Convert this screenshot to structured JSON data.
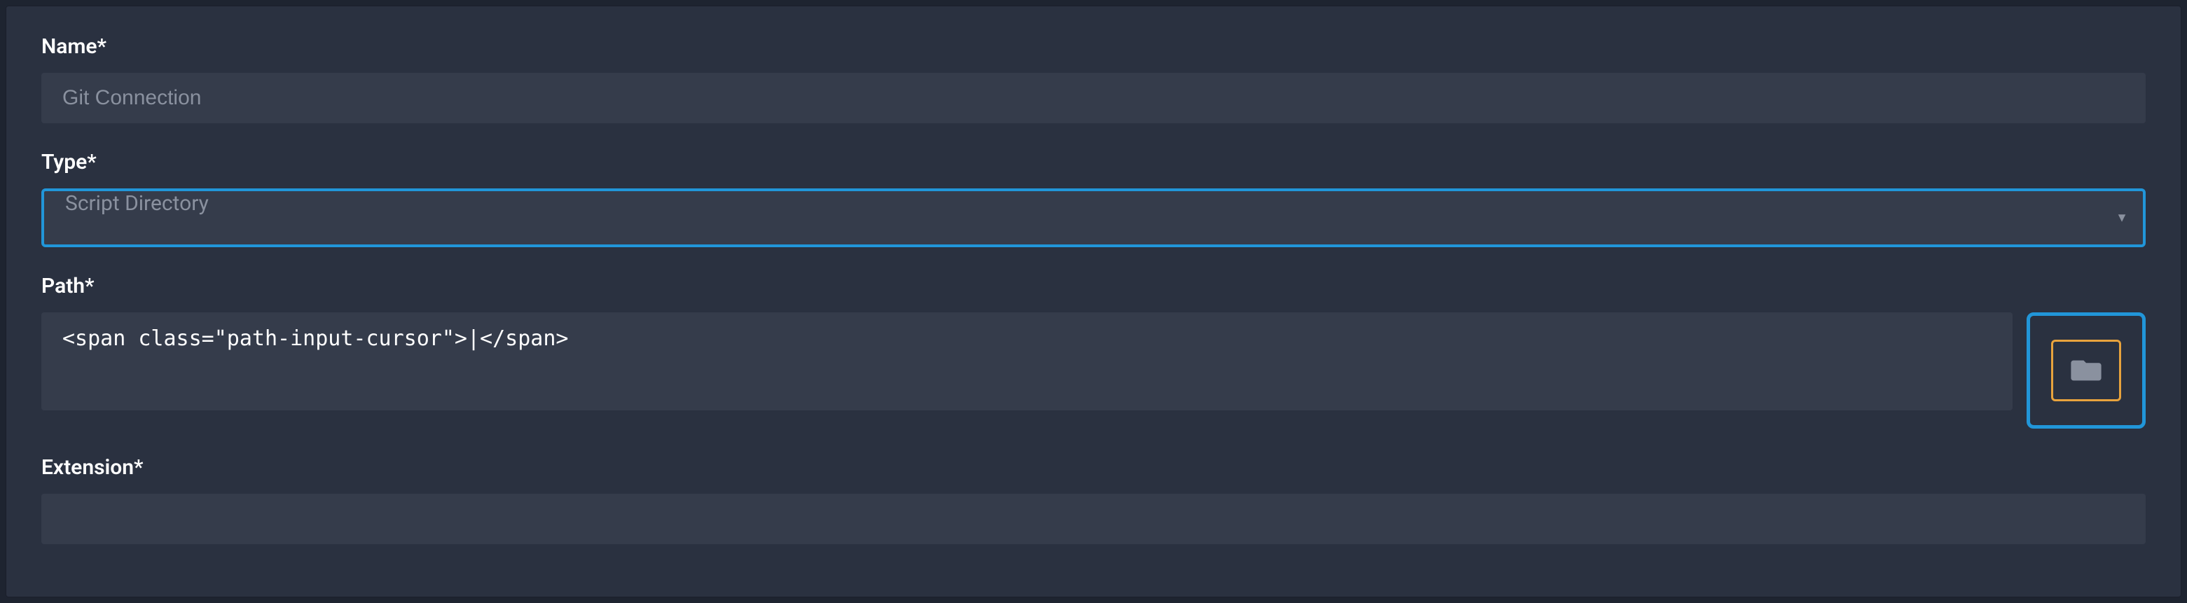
{
  "labels": {
    "name": "Name*",
    "type": "Type*",
    "path": "Path*",
    "extension": "Extension*"
  },
  "fields": {
    "name": {
      "placeholder": "Git Connection",
      "value": ""
    },
    "type": {
      "selected": "Script Directory",
      "value": ""
    },
    "path": {
      "value": ""
    },
    "extension": {
      "value": ""
    }
  },
  "colors": {
    "focus_border": "#2196d9",
    "warning_border": "#e8a33d",
    "input_bg": "#353c4b",
    "panel_bg": "#2a3140",
    "page_bg": "#1e2430"
  }
}
